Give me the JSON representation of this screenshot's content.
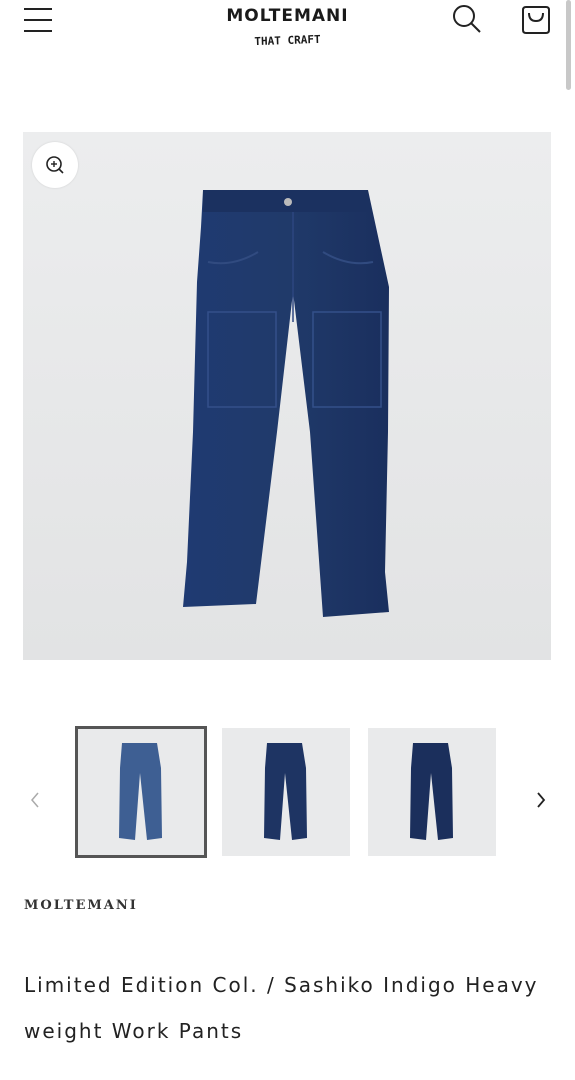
{
  "header": {
    "logo_main": "MOLTEMANI",
    "logo_sub": "THAT CRAFT",
    "menu_icon": "hamburger-menu-icon",
    "search_icon": "search-icon",
    "cart_icon": "shopping-bag-icon"
  },
  "gallery": {
    "zoom_icon": "zoom-in-icon",
    "prev_icon": "chevron-left-icon",
    "next_icon": "chevron-right-icon",
    "thumbnails": [
      "front-light-wash",
      "front-indigo",
      "back-indigo"
    ],
    "active_thumbnail": 0
  },
  "product": {
    "vendor": "MOLTEMANI",
    "title": "Limited Edition Col. / Sashiko Indigo Heavy weight Work Pants"
  },
  "colors": {
    "indigo": "#1e3463",
    "light_wash": "#3e5f93",
    "text": "#121212"
  }
}
